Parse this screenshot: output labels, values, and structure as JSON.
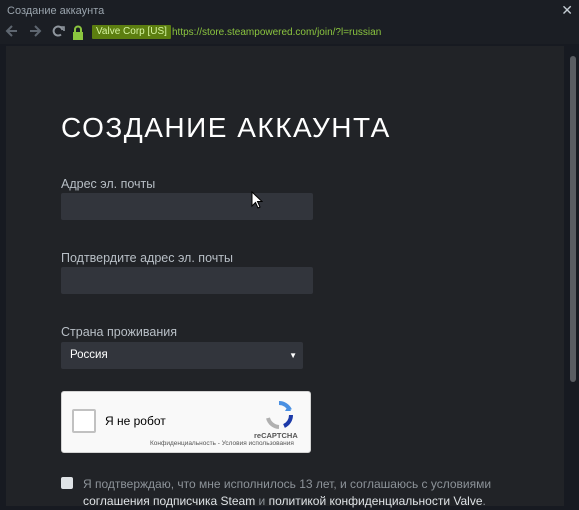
{
  "window": {
    "title": "Создание аккаунта",
    "close_glyph": "✕"
  },
  "navbar": {
    "back_icon": "back-arrow-icon",
    "forward_icon": "forward-arrow-icon",
    "reload_icon": "reload-icon",
    "lock_icon": "lock-icon",
    "certificate": "Valve Corp [US]",
    "url": "https://store.steampowered.com/join/?l=russian"
  },
  "form": {
    "heading": "СОЗДАНИЕ АККАУНТА",
    "email_label": "Адрес эл. почты",
    "email_value": "",
    "confirm_label": "Подтвердите адрес эл. почты",
    "confirm_value": "",
    "country_label": "Страна проживания",
    "country_value": "Россия"
  },
  "captcha": {
    "label": "Я не робот",
    "brand": "reCAPTCHA",
    "links": "Конфиденциальность - Условия использования"
  },
  "agreement": {
    "text_before": "Я подтверждаю, что мне исполнилось 13 лет, и соглашаюсь с условиями ",
    "link1": "соглашения подписчика Steam",
    "text_mid": " и ",
    "link2": "политикой конфиденциальности Valve",
    "text_after": "."
  },
  "colors": {
    "background": "#212327",
    "input": "#32353c",
    "accent_url": "#8bc53f",
    "cert_bg": "#5c7e10"
  }
}
